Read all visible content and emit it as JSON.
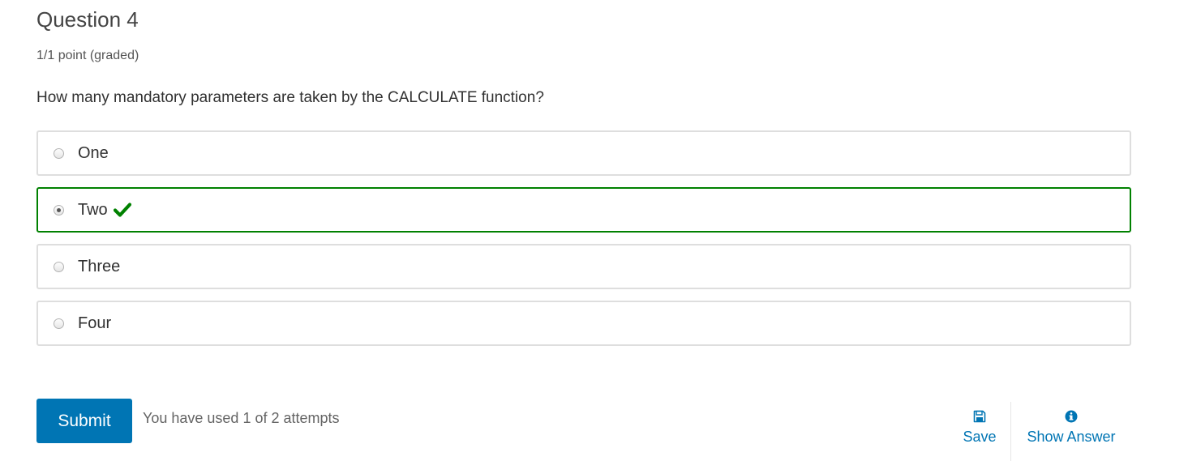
{
  "question": {
    "title": "Question 4",
    "points": "1/1 point (graded)",
    "prompt": "How many mandatory parameters are taken by the CALCULATE function?"
  },
  "choices": [
    {
      "label": "One",
      "selected": false,
      "correct": false
    },
    {
      "label": "Two",
      "selected": true,
      "correct": true
    },
    {
      "label": "Three",
      "selected": false,
      "correct": false
    },
    {
      "label": "Four",
      "selected": false,
      "correct": false
    }
  ],
  "actions": {
    "submit_label": "Submit",
    "attempts_text": "You have used 1 of 2 attempts",
    "save_label": "Save",
    "show_answer_label": "Show Answer"
  },
  "colors": {
    "accent": "#0075b4",
    "correct": "#008100",
    "border": "#dedede"
  },
  "icons": {
    "correct": "checkmark-icon",
    "save": "floppy-disk-icon",
    "show_answer": "info-circle-icon"
  }
}
